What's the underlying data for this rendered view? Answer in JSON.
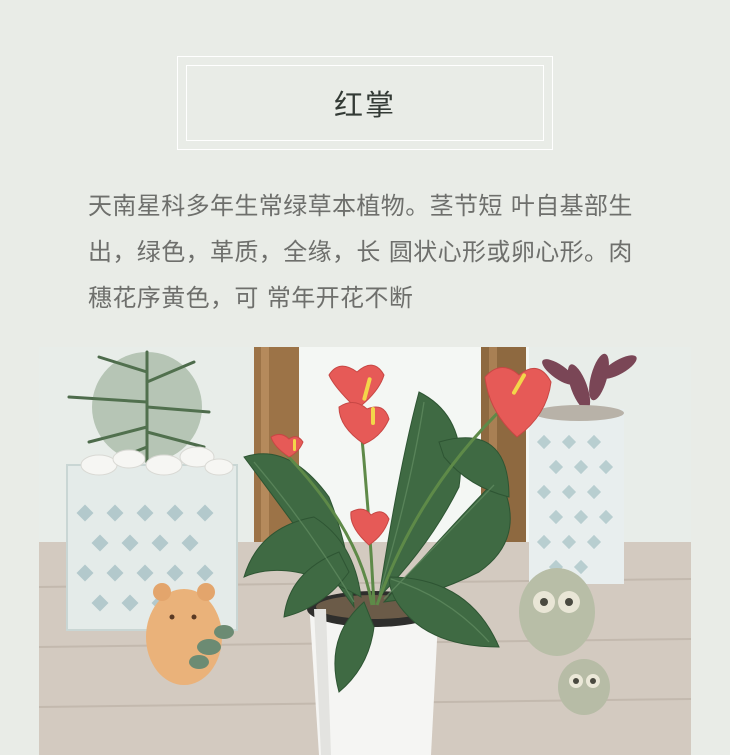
{
  "title": "红掌",
  "description": "天南星科多年生常绿草本植物。茎节短 叶自基部生出，绿色，革质，全缘，长 圆状心形或卵心形。肉穗花序黄色，可 常年开花不断",
  "photo": {
    "subject": "anthurium-plant",
    "colors": {
      "spathe": "#e65a57",
      "leaf": "#3f6a43",
      "pot": "#f4f4f2",
      "table": "#d2c8bd"
    }
  }
}
